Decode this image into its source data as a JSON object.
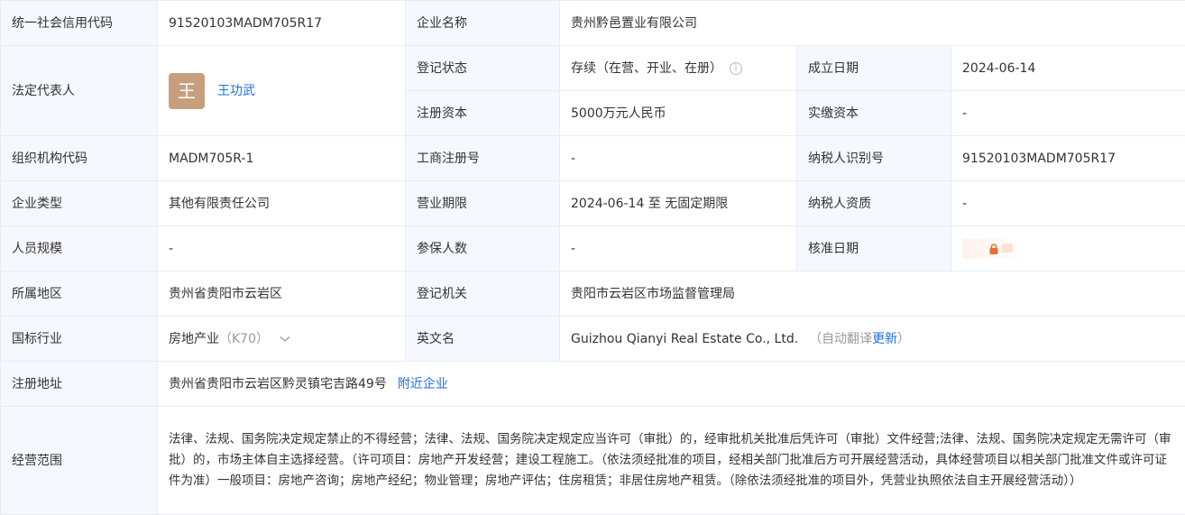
{
  "colors": {
    "label_bg": "#f5f8ff",
    "border": "#e9ecf3",
    "link": "#1d6fdc",
    "avatar_bg": "#c6a07e",
    "lock": "#e96c2f"
  },
  "rows": {
    "credit_code": {
      "label": "统一社会信用代码",
      "value": "91520103MADM705R17"
    },
    "company_name": {
      "label": "企业名称",
      "value": "贵州黔邑置业有限公司"
    },
    "legal_rep": {
      "label": "法定代表人",
      "avatar_char": "王",
      "name": "王功武"
    },
    "reg_status": {
      "label": "登记状态",
      "value": "存续（在营、开业、在册）",
      "icon": "info-circle-icon"
    },
    "founded": {
      "label": "成立日期",
      "value": "2024-06-14"
    },
    "reg_capital": {
      "label": "注册资本",
      "value": "5000万元人民币"
    },
    "paid_capital": {
      "label": "实缴资本",
      "value": "-"
    },
    "org_code": {
      "label": "组织机构代码",
      "value": "MADM705R-1"
    },
    "biz_reg_no": {
      "label": "工商注册号",
      "value": "-"
    },
    "taxpayer_id": {
      "label": "纳税人识别号",
      "value": "91520103MADM705R17"
    },
    "company_type": {
      "label": "企业类型",
      "value": "其他有限责任公司"
    },
    "biz_term": {
      "label": "营业期限",
      "value": "2024-06-14 至 无固定期限"
    },
    "taxpayer_qual": {
      "label": "纳税人资质",
      "value": "-"
    },
    "staff_size": {
      "label": "人员规模",
      "value": "-"
    },
    "insured": {
      "label": "参保人数",
      "value": "-"
    },
    "approval_date": {
      "label": "核准日期",
      "icon": "lock-icon"
    },
    "region": {
      "label": "所属地区",
      "value": "贵州省贵阳市云岩区"
    },
    "reg_authority": {
      "label": "登记机关",
      "value": "贵阳市云岩区市场监督管理局"
    },
    "industry": {
      "label": "国标行业",
      "value": "房地产业",
      "code": "（K70）",
      "icon": "chevron-down-icon"
    },
    "english_name": {
      "label": "英文名",
      "value": "Guizhou Qianyi Real Estate Co., Ltd.",
      "auto_prefix": "（自动翻译",
      "update_link": "更新",
      "auto_suffix": "）"
    },
    "address": {
      "label": "注册地址",
      "value": "贵州省贵阳市云岩区黔灵镇宅吉路49号",
      "nearby_link": "附近企业"
    },
    "scope": {
      "label": "经营范围",
      "value": "法律、法规、国务院决定规定禁止的不得经营；法律、法规、国务院决定规定应当许可（审批）的，经审批机关批准后凭许可（审批）文件经营;法律、法规、国务院决定规定无需许可（审批）的，市场主体自主选择经营。（许可项目：房地产开发经营；建设工程施工。（依法须经批准的项目，经相关部门批准后方可开展经营活动，具体经营项目以相关部门批准文件或许可证件为准）一般项目：房地产咨询；房地产经纪；物业管理；房地产评估；住房租赁；非居住房地产租赁。（除依法须经批准的项目外，凭营业执照依法自主开展经营活动））"
    }
  }
}
